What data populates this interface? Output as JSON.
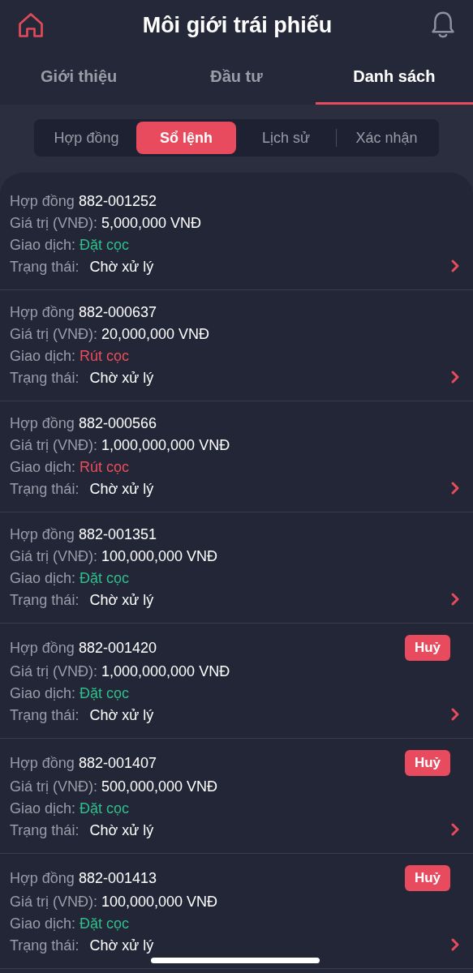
{
  "header": {
    "title": "Môi giới trái phiếu"
  },
  "tabs": [
    {
      "label": "Giới thiệu",
      "selected": false
    },
    {
      "label": "Đầu tư",
      "selected": false
    },
    {
      "label": "Danh sách",
      "selected": true
    }
  ],
  "segments": [
    {
      "label": "Hợp đồng",
      "selected": false
    },
    {
      "label": "Sổ lệnh",
      "selected": true
    },
    {
      "label": "Lịch sử",
      "selected": false
    },
    {
      "label": "Xác nhận",
      "selected": false
    }
  ],
  "orders": [
    {
      "contract_label": "Hợp đồng",
      "contract": "882-001252",
      "value_label": "Giá trị (VNĐ):",
      "value": "5,000,000 VNĐ",
      "transaction_label": "Giao dịch:",
      "transaction": "Đặt cọc",
      "kind": "deposit",
      "status_label": "Trạng thái:",
      "status": "Chờ xử lý"
    },
    {
      "contract_label": "Hợp đồng",
      "contract": "882-000637",
      "value_label": "Giá trị (VNĐ):",
      "value": "20,000,000 VNĐ",
      "transaction_label": "Giao dịch:",
      "transaction": "Rút cọc",
      "kind": "withdraw",
      "status_label": "Trạng thái:",
      "status": "Chờ xử lý"
    },
    {
      "contract_label": "Hợp đồng",
      "contract": "882-000566",
      "value_label": "Giá trị (VNĐ):",
      "value": "1,000,000,000 VNĐ",
      "transaction_label": "Giao dịch:",
      "transaction": "Rút cọc",
      "kind": "withdraw",
      "status_label": "Trạng thái:",
      "status": "Chờ xử lý"
    },
    {
      "contract_label": "Hợp đồng",
      "contract": "882-001351",
      "value_label": "Giá trị (VNĐ):",
      "value": "100,000,000 VNĐ",
      "transaction_label": "Giao dịch:",
      "transaction": "Đặt cọc",
      "kind": "deposit",
      "status_label": "Trạng thái:",
      "status": "Chờ xử lý"
    },
    {
      "contract_label": "Hợp đồng",
      "contract": "882-001420",
      "value_label": "Giá trị (VNĐ):",
      "value": "1,000,000,000 VNĐ",
      "transaction_label": "Giao dịch:",
      "transaction": "Đặt cọc",
      "kind": "deposit",
      "status_label": "Trạng thái:",
      "status": "Chờ xử lý",
      "cancel": "Huỷ"
    },
    {
      "contract_label": "Hợp đồng",
      "contract": "882-001407",
      "value_label": "Giá trị (VNĐ):",
      "value": "500,000,000 VNĐ",
      "transaction_label": "Giao dịch:",
      "transaction": "Đặt cọc",
      "kind": "deposit",
      "status_label": "Trạng thái:",
      "status": "Chờ xử lý",
      "cancel": "Huỷ"
    },
    {
      "contract_label": "Hợp đồng",
      "contract": "882-001413",
      "value_label": "Giá trị (VNĐ):",
      "value": "100,000,000 VNĐ",
      "transaction_label": "Giao dịch:",
      "transaction": "Đặt cọc",
      "kind": "deposit",
      "status_label": "Trạng thái:",
      "status": "Chờ xử lý",
      "cancel": "Huỷ"
    }
  ]
}
